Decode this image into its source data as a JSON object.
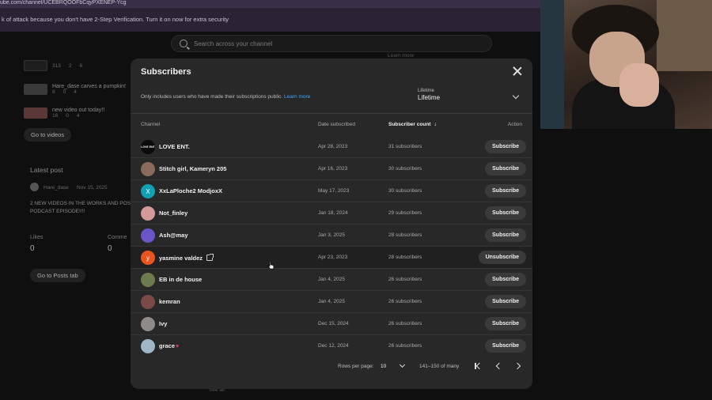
{
  "browser": {
    "url": "ube.com/channel/UCEBRQOOFbCqyPXENEP-Ycg",
    "security_banner": "k of attack because you don't have 2-Step Verification. Turn it on now for extra security"
  },
  "search": {
    "placeholder": "Search across your channel"
  },
  "background": {
    "content_rows": [
      {
        "title": "",
        "views": "313",
        "comments": "2",
        "likes": "6"
      },
      {
        "title": "Hare_dase carves a pumpkin!",
        "views": "8",
        "comments": "0",
        "likes": "4"
      },
      {
        "title": "new video out today!!",
        "views": "16",
        "comments": "0",
        "likes": "4"
      }
    ],
    "go_to_videos": "Go to videos",
    "latest_post_heading": "Latest post",
    "post_author": "Hare_dase",
    "post_date": "Nov 15, 2025",
    "post_text": "2 NEW VIDEOS IN THE WORKS AND POS PODCAST EPISODE!!!!",
    "likes_label": "Likes",
    "likes_value": "0",
    "comments_label": "Comme",
    "comments_value": "0",
    "go_to_posts": "Go to Posts tab",
    "learn_more": "Learn more",
    "see_all": "See all"
  },
  "modal": {
    "title": "Subscribers",
    "note": "Only includes users who have made their subscriptions public.",
    "learn_more": "Learn more",
    "period_label": "Lifetime",
    "period_value": "Lifetime",
    "columns": {
      "channel": "Channel",
      "date": "Date subscribed",
      "count": "Subscriber count",
      "action": "Action"
    },
    "sort_arrow": "↓",
    "rows": [
      {
        "name": "LOVE ENT.",
        "date": "Apr 28, 2023",
        "count": "31 subscribers",
        "action": "Subscribe",
        "avatar_letter": "LOVE ENT",
        "avatar_color": "#0b0b0b"
      },
      {
        "name": "Stitch girl, Kameryn 205",
        "date": "Apr 16, 2023",
        "count": "30 subscribers",
        "action": "Subscribe",
        "avatar_letter": "",
        "avatar_color": "#8a6a5a"
      },
      {
        "name": "XxLaPloche2 ModjoxX",
        "date": "May 17, 2023",
        "count": "30 subscribers",
        "action": "Subscribe",
        "avatar_letter": "X",
        "avatar_color": "#12a0b3"
      },
      {
        "name": "Not_finley",
        "date": "Jan 18, 2024",
        "count": "29 subscribers",
        "action": "Subscribe",
        "avatar_letter": "",
        "avatar_color": "#d49a9a"
      },
      {
        "name": "Ash@may",
        "date": "Jan 3, 2025",
        "count": "28 subscribers",
        "action": "Subscribe",
        "avatar_letter": "",
        "avatar_color": "#6a55c8"
      },
      {
        "name": "yasmine valdez",
        "date": "Apr 23, 2023",
        "count": "28 subscribers",
        "action": "Unsubscribe",
        "avatar_letter": "y",
        "avatar_color": "#e8551f"
      },
      {
        "name": "EB in de house",
        "date": "Jan 4, 2025",
        "count": "26 subscribers",
        "action": "Subscribe",
        "avatar_letter": "",
        "avatar_color": "#6d7a4c"
      },
      {
        "name": "kemran",
        "date": "Jan 4, 2025",
        "count": "26 subscribers",
        "action": "Subscribe",
        "avatar_letter": "",
        "avatar_color": "#7a4a48"
      },
      {
        "name": "Ivy",
        "date": "Dec 15, 2024",
        "count": "26 subscribers",
        "action": "Subscribe",
        "avatar_letter": "",
        "avatar_color": "#8d8a88"
      },
      {
        "name": "grace",
        "date": "Dec 12, 2024",
        "count": "26 subscribers",
        "action": "Subscribe",
        "avatar_letter": "",
        "avatar_color": "#9fb6c8"
      }
    ],
    "pager": {
      "rows_per_page_label": "Rows per page:",
      "rows_per_page_value": "10",
      "range": "141–150 of many"
    }
  },
  "icons": {
    "close": "close-icon",
    "search": "search-icon",
    "chevron": "chevron-down-icon",
    "heart": "♥",
    "external": "external-link-icon"
  }
}
